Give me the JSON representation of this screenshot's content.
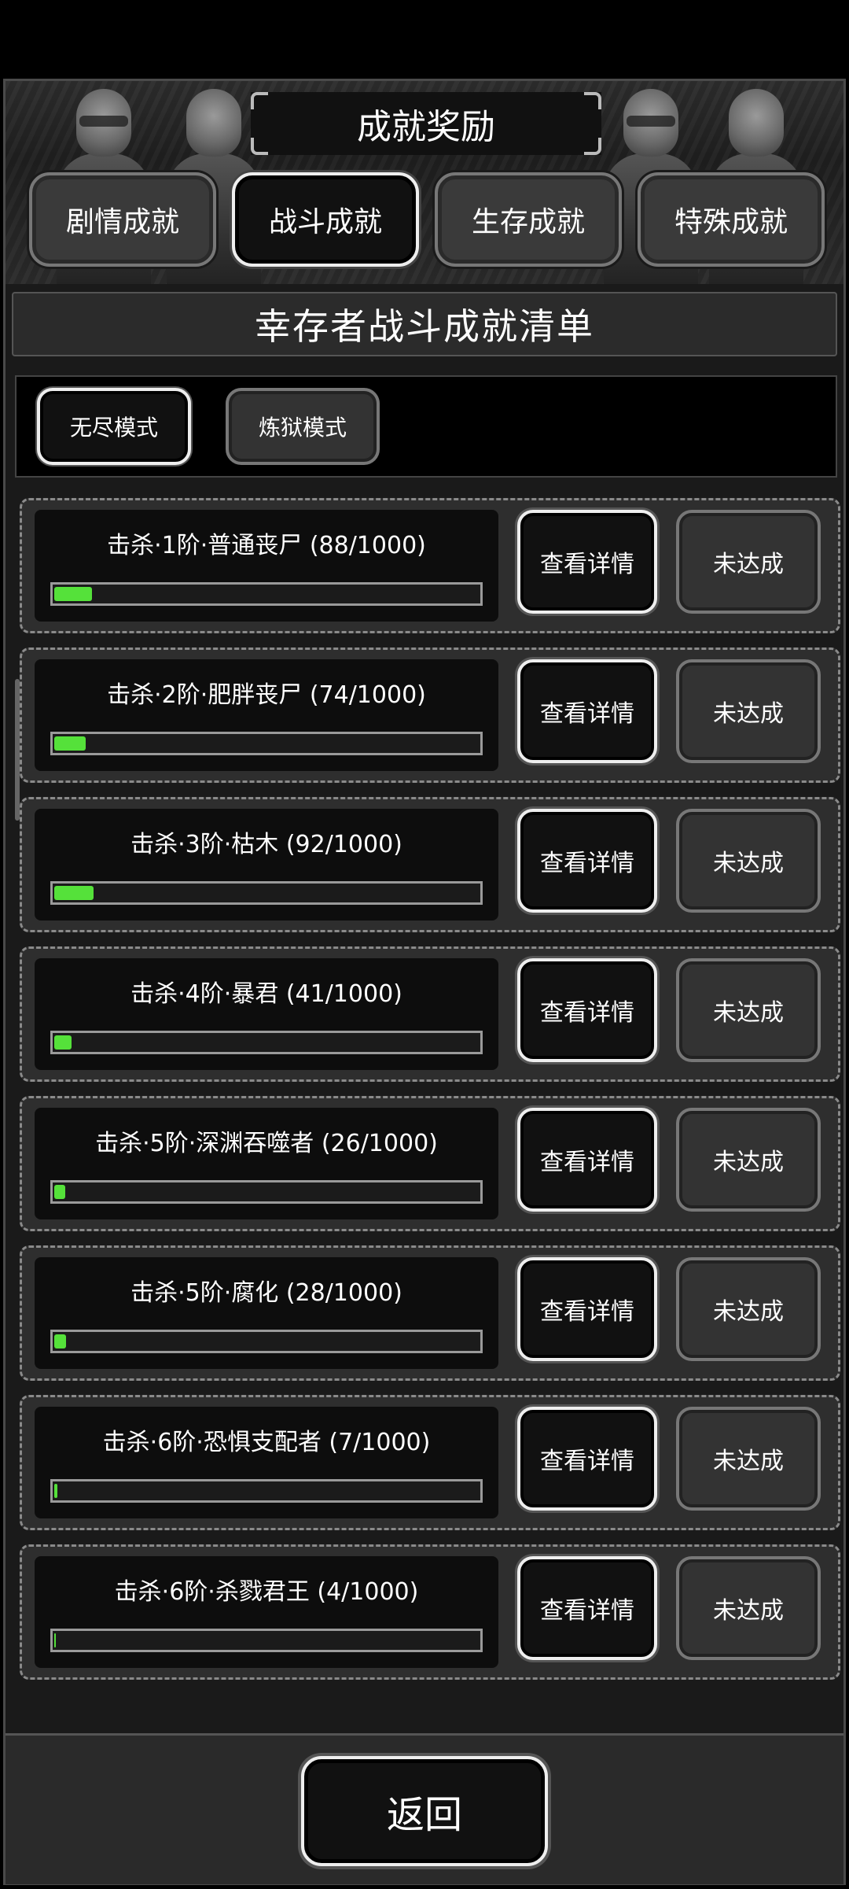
{
  "header": {
    "title": "成就奖励"
  },
  "tabs": [
    {
      "label": "剧情成就",
      "active": false
    },
    {
      "label": "战斗成就",
      "active": true
    },
    {
      "label": "生存成就",
      "active": false
    },
    {
      "label": "特殊成就",
      "active": false
    }
  ],
  "subtitle": "幸存者战斗成就清单",
  "modes": [
    {
      "label": "无尽模式",
      "active": true
    },
    {
      "label": "炼狱模式",
      "active": false
    }
  ],
  "achievements": [
    {
      "label": "击杀·1阶·普通丧尸 (88/1000)",
      "progress": 0.088,
      "detail_label": "查看详情",
      "status_label": "未达成"
    },
    {
      "label": "击杀·2阶·肥胖丧尸 (74/1000)",
      "progress": 0.074,
      "detail_label": "查看详情",
      "status_label": "未达成"
    },
    {
      "label": "击杀·3阶·枯木 (92/1000)",
      "progress": 0.092,
      "detail_label": "查看详情",
      "status_label": "未达成"
    },
    {
      "label": "击杀·4阶·暴君 (41/1000)",
      "progress": 0.041,
      "detail_label": "查看详情",
      "status_label": "未达成"
    },
    {
      "label": "击杀·5阶·深渊吞噬者 (26/1000)",
      "progress": 0.026,
      "detail_label": "查看详情",
      "status_label": "未达成"
    },
    {
      "label": "击杀·5阶·腐化 (28/1000)",
      "progress": 0.028,
      "detail_label": "查看详情",
      "status_label": "未达成"
    },
    {
      "label": "击杀·6阶·恐惧支配者 (7/1000)",
      "progress": 0.007,
      "detail_label": "查看详情",
      "status_label": "未达成"
    },
    {
      "label": "击杀·6阶·杀戮君王 (4/1000)",
      "progress": 0.004,
      "detail_label": "查看详情",
      "status_label": "未达成"
    }
  ],
  "footer": {
    "back_label": "返回"
  },
  "colors": {
    "progress_fill": "#55e13a",
    "active_border": "#eeeeee"
  }
}
